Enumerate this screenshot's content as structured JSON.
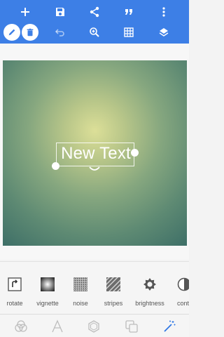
{
  "colors": {
    "toolbar": "#3d7fe6",
    "accent": "#2f77e4",
    "icon_grey": "#bdbdbd"
  },
  "toolbar": {
    "icons": [
      "add-icon",
      "save-icon",
      "share-icon",
      "quote-icon",
      "more-vert-icon",
      "pencil-icon",
      "delete-icon",
      "undo-icon",
      "zoom-in-icon",
      "grid-icon",
      "layers-icon"
    ]
  },
  "canvas": {
    "text": "New Text"
  },
  "effects": [
    {
      "label": "rotate",
      "icon": "rotate-icon"
    },
    {
      "label": "vignette",
      "icon": "vignette-icon"
    },
    {
      "label": "noise",
      "icon": "noise-icon"
    },
    {
      "label": "stripes",
      "icon": "stripes-icon"
    },
    {
      "label": "brightness",
      "icon": "brightness-icon"
    },
    {
      "label": "contr",
      "icon": "contrast-icon"
    }
  ],
  "bottom_nav": {
    "items": [
      "color-circles-icon",
      "text-icon",
      "shape-icon",
      "overlay-icon",
      "magic-wand-icon"
    ],
    "active_index": 4
  }
}
